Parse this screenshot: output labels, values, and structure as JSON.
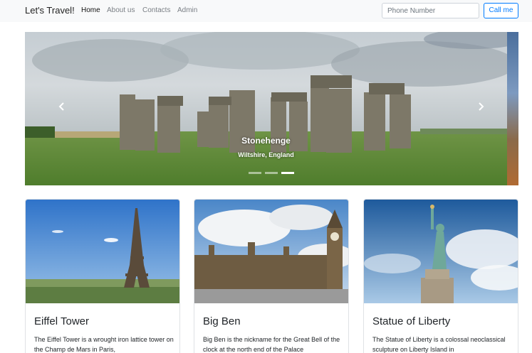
{
  "navbar": {
    "brand": "Let's Travel!",
    "links": [
      {
        "label": "Home",
        "active": true
      },
      {
        "label": "About us",
        "active": false
      },
      {
        "label": "Contacts",
        "active": false
      },
      {
        "label": "Admin",
        "active": false
      }
    ],
    "phone_placeholder": "Phone Number",
    "call_label": "Call me"
  },
  "carousel": {
    "title": "Stonehenge",
    "subtitle": "Wiltshire, England",
    "prev_icon": "chevron-left-icon",
    "next_icon": "chevron-right-icon",
    "indicator_count": 3,
    "active_index": 2
  },
  "cards": [
    {
      "title": "Eiffel Tower",
      "text": "The Eiffel Tower is a wrought iron lattice tower on the Champ de Mars in Paris,"
    },
    {
      "title": "Big Ben",
      "text": "Big Ben is the nickname for the Great Bell of the clock at the north end of the Palace"
    },
    {
      "title": "Statue of Liberty",
      "text": "The Statue of Liberty is a colossal neoclassical sculpture on Liberty Island in"
    }
  ],
  "colors": {
    "accent": "#007bff",
    "navbar_bg": "#f8f9fa"
  }
}
